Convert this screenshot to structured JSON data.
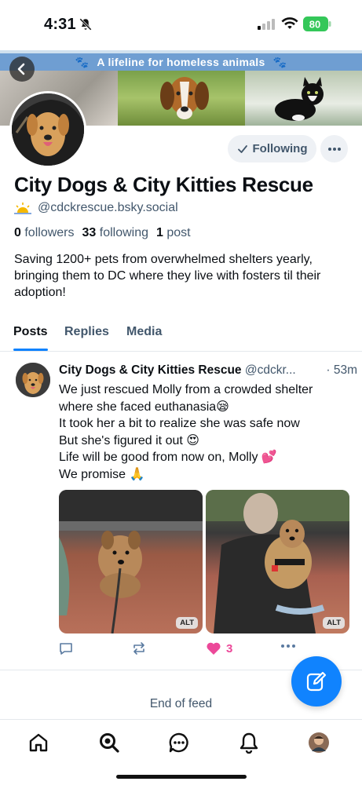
{
  "status_bar": {
    "time": "4:31",
    "battery_percent": "80",
    "icons": [
      "bell-off-icon",
      "signal-icon",
      "wifi-icon",
      "battery-charging-icon"
    ]
  },
  "banner": {
    "text": "A lifeline for homeless animals",
    "strip_color": "#6f9ed2"
  },
  "profile": {
    "name": "City Dogs & City Kitties Rescue",
    "handle": "@cdckrescue.bsky.social",
    "followers_count": "0",
    "followers_label": "followers",
    "following_count": "33",
    "following_label": "following",
    "posts_count": "1",
    "posts_label": "post",
    "bio": "Saving 1200+ pets from overwhelmed shelters yearly, bringing them to DC where they live with fosters til their adoption!",
    "follow_button_label": "Following"
  },
  "tabs": [
    {
      "label": "Posts",
      "active": true
    },
    {
      "label": "Replies",
      "active": false
    },
    {
      "label": "Media",
      "active": false
    }
  ],
  "post": {
    "author": "City Dogs & City Kitties Rescue",
    "handle": "@cdckr...",
    "time": "· 53m",
    "lines": [
      "We just rescued Molly from a crowded shelter",
      "where she faced euthanasia😪",
      "It took her a bit to realize she was safe now",
      "But she's figured it out 😍",
      "Life will be good from now on, Molly 💕",
      "We promise 🙏"
    ],
    "images": [
      {
        "alt_label": "ALT"
      },
      {
        "alt_label": "ALT"
      }
    ],
    "like_count": "3"
  },
  "feed": {
    "end_text": "End of feed"
  },
  "colors": {
    "accent": "#1083fe",
    "like": "#ec4899",
    "muted_text": "#42576c"
  }
}
